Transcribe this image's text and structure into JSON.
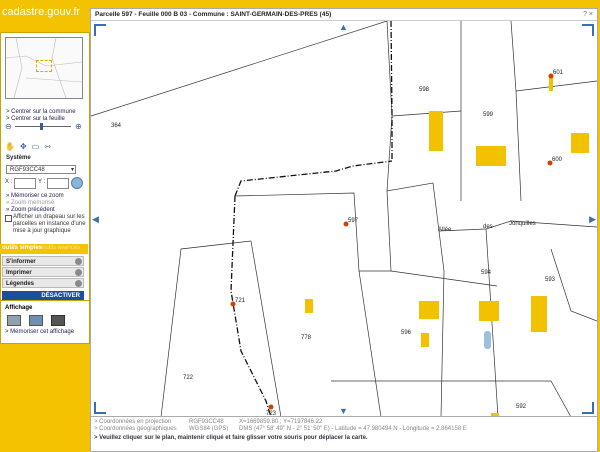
{
  "site": {
    "logo": "cadastre.gouv.fr"
  },
  "map": {
    "title": "Parcelle 597 - Feuille 000 B 03 - Commune : SAINT-GERMAIN-DES-PRES (45)",
    "window_controls": "? ×",
    "parcels": [
      "364",
      "598",
      "599",
      "601",
      "600",
      "597",
      "594",
      "593",
      "721",
      "778",
      "596",
      "722",
      "723",
      "592"
    ],
    "street": [
      "Allée",
      "des",
      "Jonquilles"
    ]
  },
  "sidebar": {
    "links_top": [
      "> Centrer sur la commune",
      "> Centrer sur la feuille"
    ],
    "systeme_label": "Système",
    "systeme_value": "RGF93CC48",
    "x_label": "X :",
    "y_label": "Y :",
    "links_mid": [
      "» Mémoriser ce zoom",
      "» Zoom mémorisé",
      "» Zoom précédent"
    ],
    "flag_label": "Afficher un drapeau sur les parcelles en instance d'une mise à jour graphique",
    "tab_simple": "outils simples",
    "tab_advanced": "outils avancés",
    "bars": [
      "S'informer",
      "Imprimer",
      "Légendes"
    ],
    "desactiver": "DÉSACTIVER",
    "affichage_label": "Affichage",
    "memoriser_affichage": "> Mémoriser cet affichage"
  },
  "info": {
    "proj_label": "> Coordonnées en projection",
    "proj_system": "RGF93CC48",
    "proj_value": "X=1669859.80 ; Y=7197846.22",
    "geo_label": "> Coordonnées géographiques",
    "geo_system": "WGS84 (GPS)",
    "geo_value": "DMS (47° 58' 49\" N - 2° 51' 50\" E) - Latitude = 47.980494 N - Longitude = 2.864158 E",
    "hint": "> Veuillez cliquer sur le plan, maintenir cliqué et faire glisser votre souris pour déplacer la carte."
  },
  "colors": {
    "accent": "#f3c200",
    "building": "#f2c100",
    "nav": "#3a6fb0",
    "button_dark": "#1a4f9c"
  },
  "icons": [
    "zoom-in-icon",
    "zoom-out-icon",
    "hand-pan-icon",
    "move-icon",
    "select-box-icon",
    "measure-icon",
    "go-icon",
    "layer-icon"
  ]
}
